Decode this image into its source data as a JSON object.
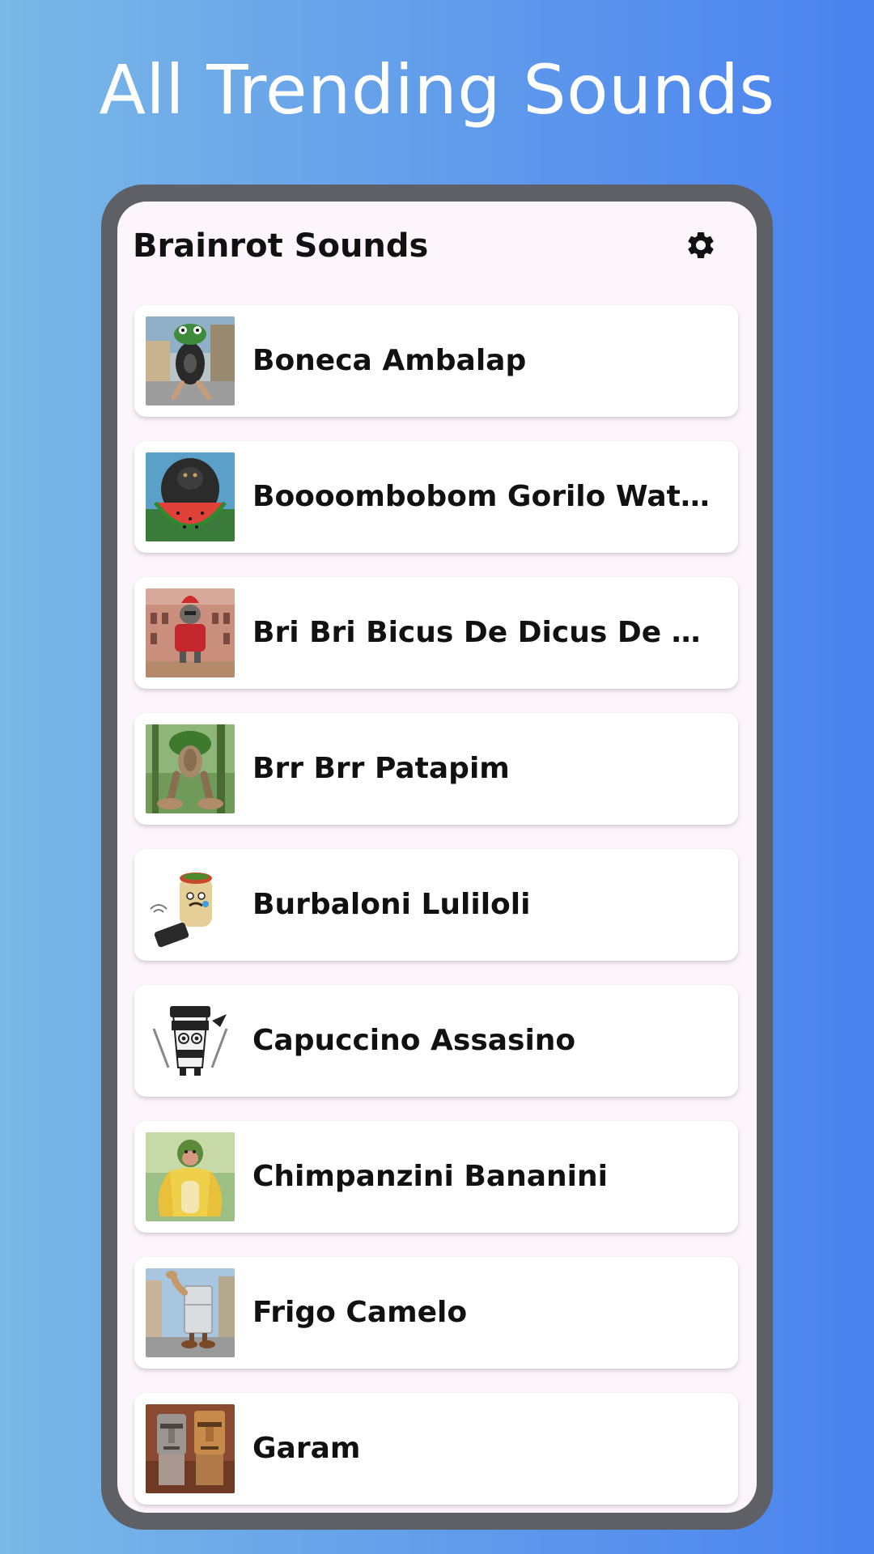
{
  "banner": {
    "title": "All Trending Sounds"
  },
  "app_bar": {
    "title": "Brainrot Sounds",
    "settings_icon": "gear-icon"
  },
  "sounds": [
    {
      "name": "Boneca Ambalap",
      "thumbnail": "frog-tire-thumbnail"
    },
    {
      "name": "Boooombobom Gorilo Water…",
      "thumbnail": "gorilla-watermelon-thumbnail"
    },
    {
      "name": "Bri Bri Bicus De Dicus De Bic…",
      "thumbnail": "roman-soldier-thumbnail"
    },
    {
      "name": "Brr Brr Patapim",
      "thumbnail": "tree-creature-thumbnail"
    },
    {
      "name": "Burbaloni Luliloli",
      "thumbnail": "burrito-phone-thumbnail"
    },
    {
      "name": "Capuccino Assasino",
      "thumbnail": "coffee-ninja-thumbnail"
    },
    {
      "name": "Chimpanzini Bananini",
      "thumbnail": "chimp-banana-thumbnail"
    },
    {
      "name": "Frigo Camelo",
      "thumbnail": "camel-fridge-thumbnail"
    },
    {
      "name": "Garam",
      "thumbnail": "stone-heads-thumbnail"
    }
  ],
  "colors": {
    "background_gradient_start": "#7ab8e6",
    "background_gradient_end": "#4a82ef",
    "phone_frame": "#5f6065",
    "screen_background": "#fcf5fb",
    "card_background": "#ffffff",
    "text_primary": "#111111"
  }
}
